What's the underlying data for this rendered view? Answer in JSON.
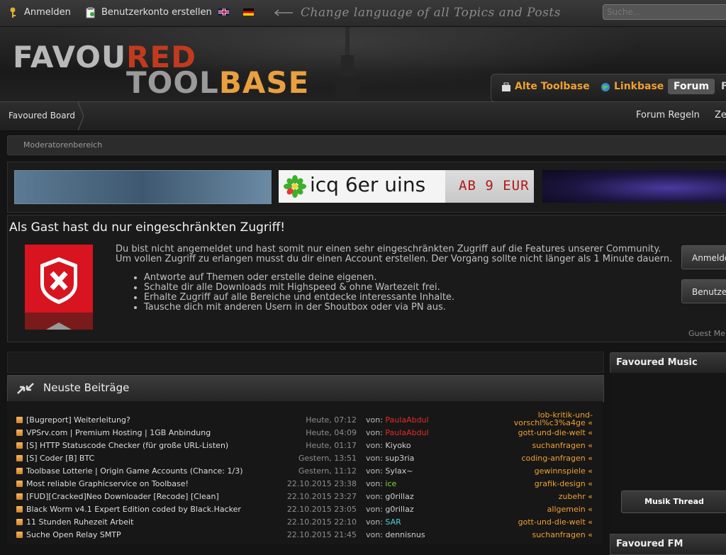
{
  "topbar": {
    "login": "Anmelden",
    "register": "Benutzerkonto erstellen",
    "lang_hint": "Change language of all Topics and Posts",
    "search_placeholder": "Suche..."
  },
  "logo": {
    "line1_a": "FAVOU",
    "line1_b": "RED",
    "line2_a": "TOOL",
    "line2_b": "BASE"
  },
  "header_nav": {
    "items": [
      "Alte Toolbase",
      "Linkbase",
      "Forum",
      "F"
    ]
  },
  "breadcrumb": {
    "home": "Favoured Board"
  },
  "top_nav": {
    "items": [
      "Forum Regeln",
      "Ze"
    ]
  },
  "moderator_bar": "Moderatorenbereich",
  "banners": {
    "icq_text": "icq 6er uins",
    "icq_price": "AB 9 EUR"
  },
  "guest": {
    "title": "Als Gast hast du nur eingeschränkten Zugriff!",
    "text1": "Du bist nicht angemeldet und hast somit nur einen sehr eingeschränkten Zugriff auf die Features unserer Community.",
    "text2": "Um vollen Zugriff zu erlangen musst du dir einen Account erstellen. Der Vorgang sollte nicht länger als 1 Minute dauern.",
    "bullets": [
      "Antworte auf Themen oder erstelle deine eigenen.",
      "Schalte dir alle Downloads mit Highspeed & ohne Wartezeit frei.",
      "Erhalte Zugriff auf alle Bereiche und entdecke interessante Inhalte.",
      "Tausche dich mit anderen Usern in der Shoutbox oder via PN aus."
    ],
    "btn_login": "Anmelden",
    "btn_register": "Benutzerkonto erstellen",
    "footer": "Guest Me"
  },
  "posts": {
    "title": "Neuste Beiträge",
    "von_label": "von:",
    "rows": [
      {
        "title": "[Bugreport] Weiterleitung?",
        "time": "Heute, 07:12",
        "user": "PaulaAbdul",
        "user_color": "red",
        "cat1": "lob-kritik-und-",
        "cat2": "vorschl%c3%a4ge «"
      },
      {
        "title": "VPSrv.com | Premium Hosting | 1GB Anbindung",
        "time": "Heute, 04:09",
        "user": "PaulaAbdul",
        "user_color": "red",
        "cat1": "gott-und-die-welt «",
        "cat2": ""
      },
      {
        "title": "[S] HTTP Statuscode Checker (für große URL-Listen)",
        "time": "Heute, 01:17",
        "user": "Kiyoko",
        "user_color": "",
        "cat1": "suchanfragen «",
        "cat2": ""
      },
      {
        "title": "[S] Coder [B] BTC",
        "time": "Gestern, 13:51",
        "user": "sup3ria",
        "user_color": "",
        "cat1": "coding-anfragen «",
        "cat2": ""
      },
      {
        "title": "Toolbase Lotterie | Origin Game Accounts (Chance: 1/3)",
        "time": "Gestern, 11:12",
        "user": "Sylax~",
        "user_color": "",
        "cat1": "gewinnspiele «",
        "cat2": ""
      },
      {
        "title": "Most reliable Graphicservice on Toolbase!",
        "time": "22.10.2015 23:38",
        "user": "ice",
        "user_color": "green",
        "cat1": "grafik-design «",
        "cat2": ""
      },
      {
        "title": "[FUD][Cracked]Neo Downloader [Recode] [Clean]",
        "time": "22.10.2015 23:27",
        "user": "g0rillaz",
        "user_color": "",
        "cat1": "zubehr «",
        "cat2": ""
      },
      {
        "title": "Black Worm v4.1 Expert Edition coded by Black.Hacker",
        "time": "22.10.2015 23:05",
        "user": "g0rillaz",
        "user_color": "",
        "cat1": "allgemein «",
        "cat2": ""
      },
      {
        "title": "11 Stunden Ruhezeit Arbeit",
        "time": "22.10.2015 22:10",
        "user": "SAR",
        "user_color": "cyan",
        "cat1": "gott-und-die-welt «",
        "cat2": ""
      },
      {
        "title": "Suche Open Relay SMTP",
        "time": "22.10.2015 21:45",
        "user": "dennisnus",
        "user_color": "",
        "cat1": "suchanfragen «",
        "cat2": ""
      }
    ]
  },
  "sidebar": {
    "music_title": "Favoured Music",
    "music_button": "Musik Thread",
    "fm_title": "Favoured FM"
  },
  "colors": {
    "accent": "#f0a030",
    "user_red": "#e52a2a",
    "user_green": "#7fdc2f",
    "user_cyan": "#4fd0d8",
    "shield_red": "#d7141f"
  }
}
